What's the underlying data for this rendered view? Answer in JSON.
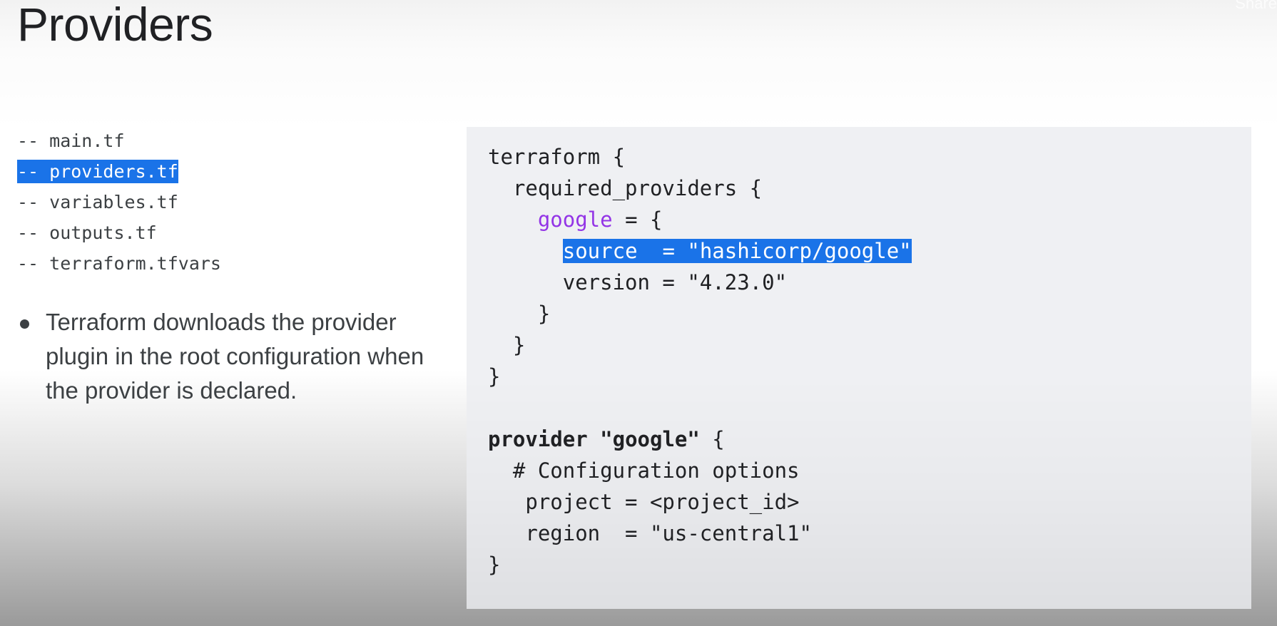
{
  "slide": {
    "title": "Providers",
    "share_hint": "Share"
  },
  "file_tree": {
    "items": [
      {
        "prefix": "-- ",
        "name": "main.tf",
        "selected": false
      },
      {
        "prefix": "-- ",
        "name": "providers.tf",
        "selected": true
      },
      {
        "prefix": "-- ",
        "name": "variables.tf",
        "selected": false
      },
      {
        "prefix": "-- ",
        "name": "outputs.tf",
        "selected": false
      },
      {
        "prefix": "-- ",
        "name": "terraform.tfvars",
        "selected": false
      }
    ]
  },
  "bullets": [
    "Terraform downloads the provider plugin in the root configuration when the provider is declared."
  ],
  "code": {
    "l1": "terraform {",
    "l2": "  required_providers {",
    "l3_key": "google",
    "l3_rest": " = {",
    "l4_highlight": "source  = \"hashicorp/google\"",
    "l5": "      version = \"4.23.0\"",
    "l6": "    }",
    "l7": "  }",
    "l8": "}",
    "l9_kw": "provider",
    "l9_name": " \"google\"",
    "l9_rest": " {",
    "l10": "  # Configuration options",
    "l11": "   project = <project_id>",
    "l12": "   region  = \"us-central1\"",
    "l13": "}"
  },
  "colors": {
    "selection": "#1a73e8",
    "keyword_google": "#9334e6",
    "code_bg": "#ebedf0"
  }
}
